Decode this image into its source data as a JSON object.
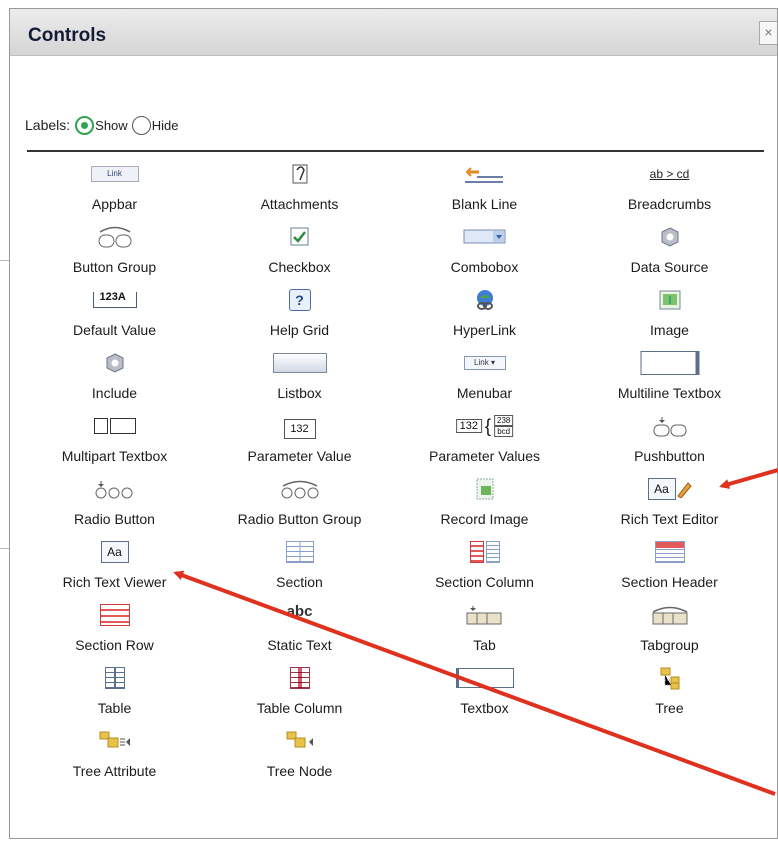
{
  "window": {
    "title": "Controls",
    "close_glyph": "×"
  },
  "labels_toggle": {
    "prefix": "Labels:",
    "options": [
      {
        "label": "Show",
        "selected": true
      },
      {
        "label": "Hide",
        "selected": false
      }
    ]
  },
  "controls": [
    {
      "label": "Appbar",
      "icon": "appbar-icon",
      "icon_text": "Link"
    },
    {
      "label": "Attachments",
      "icon": "attachments-icon"
    },
    {
      "label": "Blank Line",
      "icon": "blank-line-icon"
    },
    {
      "label": "Breadcrumbs",
      "icon": "breadcrumbs-icon",
      "icon_text": "ab > cd"
    },
    {
      "label": "Button Group",
      "icon": "button-group-icon"
    },
    {
      "label": "Checkbox",
      "icon": "checkbox-icon"
    },
    {
      "label": "Combobox",
      "icon": "combobox-icon"
    },
    {
      "label": "Data Source",
      "icon": "data-source-icon"
    },
    {
      "label": "Default Value",
      "icon": "default-value-icon",
      "icon_text": "123A"
    },
    {
      "label": "Help Grid",
      "icon": "help-grid-icon",
      "icon_text": "?"
    },
    {
      "label": "HyperLink",
      "icon": "hyperlink-icon"
    },
    {
      "label": "Image",
      "icon": "image-icon"
    },
    {
      "label": "Include",
      "icon": "include-icon"
    },
    {
      "label": "Listbox",
      "icon": "listbox-icon"
    },
    {
      "label": "Menubar",
      "icon": "menubar-icon",
      "icon_text": "Link"
    },
    {
      "label": "Multiline Textbox",
      "icon": "multiline-textbox-icon"
    },
    {
      "label": "Multipart Textbox",
      "icon": "multipart-textbox-icon"
    },
    {
      "label": "Parameter Value",
      "icon": "parameter-value-icon",
      "icon_text": "132"
    },
    {
      "label": "Parameter Values",
      "icon": "parameter-values-icon",
      "icon_text": "132",
      "icon_text2": "238",
      "icon_text3": "bcd"
    },
    {
      "label": "Pushbutton",
      "icon": "pushbutton-icon"
    },
    {
      "label": "Radio Button",
      "icon": "radio-button-icon"
    },
    {
      "label": "Radio Button Group",
      "icon": "radio-button-group-icon"
    },
    {
      "label": "Record Image",
      "icon": "record-image-icon"
    },
    {
      "label": "Rich Text Editor",
      "icon": "rich-text-editor-icon",
      "icon_text": "Aa"
    },
    {
      "label": "Rich Text Viewer",
      "icon": "rich-text-viewer-icon",
      "icon_text": "Aa"
    },
    {
      "label": "Section",
      "icon": "section-icon"
    },
    {
      "label": "Section Column",
      "icon": "section-column-icon"
    },
    {
      "label": "Section Header",
      "icon": "section-header-icon"
    },
    {
      "label": "Section Row",
      "icon": "section-row-icon"
    },
    {
      "label": "Static Text",
      "icon": "static-text-icon",
      "icon_text": "abc"
    },
    {
      "label": "Tab",
      "icon": "tab-icon"
    },
    {
      "label": "Tabgroup",
      "icon": "tabgroup-icon"
    },
    {
      "label": "Table",
      "icon": "table-icon"
    },
    {
      "label": "Table Column",
      "icon": "table-column-icon"
    },
    {
      "label": "Textbox",
      "icon": "textbox-icon"
    },
    {
      "label": "Tree",
      "icon": "tree-icon"
    },
    {
      "label": "Tree Attribute",
      "icon": "tree-attribute-icon"
    },
    {
      "label": "Tree Node",
      "icon": "tree-node-icon"
    }
  ],
  "colors": {
    "annotation_arrow": "#e0301e",
    "radio_selected": "#31a34e",
    "title_text": "#151b35"
  }
}
